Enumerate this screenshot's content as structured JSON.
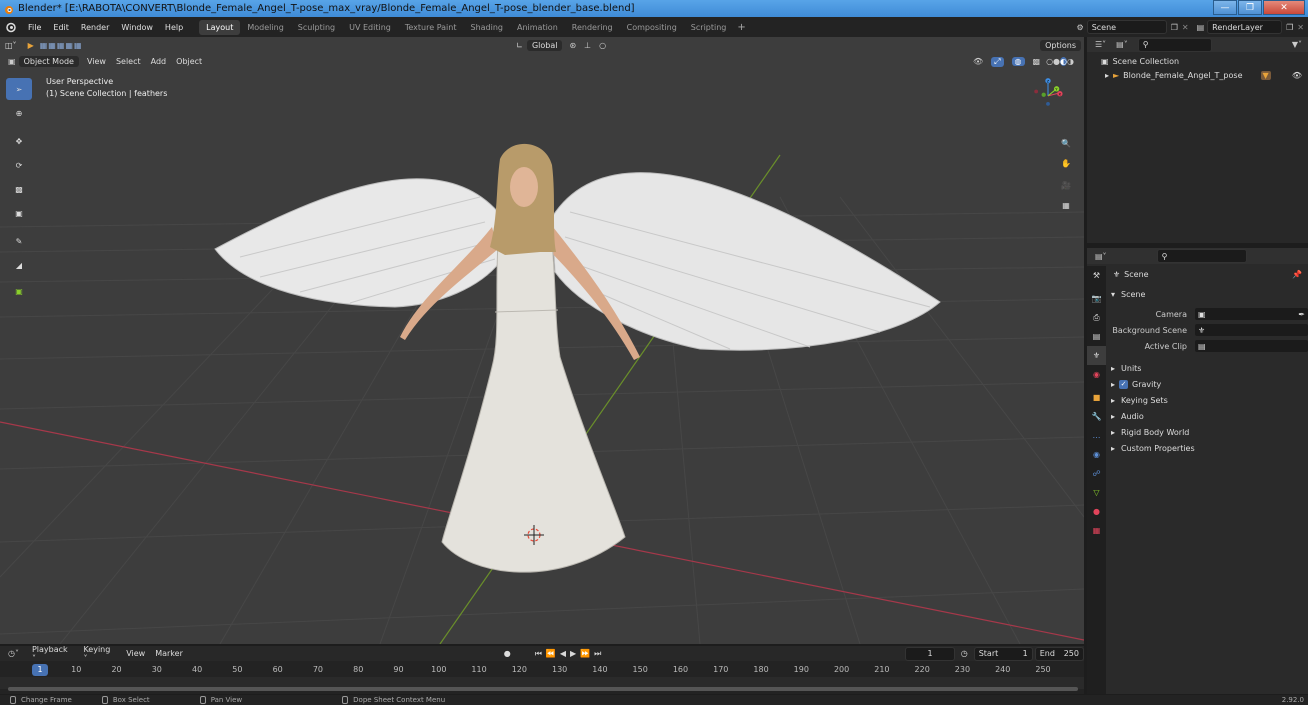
{
  "window": {
    "title": "Blender* [E:\\RABOTA\\CONVERT\\Blonde_Female_Angel_T-pose_max_vray/Blonde_Female_Angel_T-pose_blender_base.blend]"
  },
  "menubar": {
    "menus": [
      "File",
      "Edit",
      "Render",
      "Window",
      "Help"
    ],
    "workspaces": [
      "Layout",
      "Modeling",
      "Sculpting",
      "UV Editing",
      "Texture Paint",
      "Shading",
      "Animation",
      "Rendering",
      "Compositing",
      "Scripting"
    ],
    "active_workspace": "Layout",
    "scene": "Scene",
    "view_layer": "RenderLayer"
  },
  "viewport": {
    "transform_orientation": "Global",
    "options_label": "Options",
    "mode": "Object Mode",
    "menus": [
      "View",
      "Select",
      "Add",
      "Object"
    ],
    "view_name": "User Perspective",
    "collection_info": "(1) Scene Collection | feathers",
    "gizmo_axes": [
      "Z",
      "Y",
      "X"
    ]
  },
  "outliner": {
    "root": "Scene Collection",
    "items": [
      {
        "label": "Blonde_Female_Angel_T_pose"
      }
    ]
  },
  "properties": {
    "context": "Scene",
    "panel": "Scene",
    "fields": [
      {
        "label": "Camera"
      },
      {
        "label": "Background Scene"
      },
      {
        "label": "Active Clip"
      }
    ],
    "panels": [
      {
        "label": "Units",
        "checkbox": false
      },
      {
        "label": "Gravity",
        "checkbox": true
      },
      {
        "label": "Keying Sets",
        "checkbox": false
      },
      {
        "label": "Audio",
        "checkbox": false
      },
      {
        "label": "Rigid Body World",
        "checkbox": false
      },
      {
        "label": "Custom Properties",
        "checkbox": false
      }
    ]
  },
  "timeline": {
    "menus": [
      "Playback",
      "Keying",
      "View",
      "Marker"
    ],
    "current_frame": "1",
    "start_label": "Start",
    "start": "1",
    "end_label": "End",
    "end": "250",
    "ruler": [
      "1",
      "10",
      "20",
      "30",
      "40",
      "50",
      "60",
      "70",
      "80",
      "90",
      "100",
      "110",
      "120",
      "130",
      "140",
      "150",
      "160",
      "170",
      "180",
      "190",
      "200",
      "210",
      "220",
      "230",
      "240",
      "250"
    ]
  },
  "statusbar": {
    "items": [
      "Change Frame",
      "Box Select",
      "Pan View",
      "Dope Sheet Context Menu"
    ],
    "version": "2.92.0"
  },
  "colors": {
    "accent": "#4772b3",
    "viewport_bg": "#3d3d3d",
    "x_axis": "#e2445b",
    "y_axis": "#8ad02b",
    "z_axis": "#3e8de2"
  }
}
